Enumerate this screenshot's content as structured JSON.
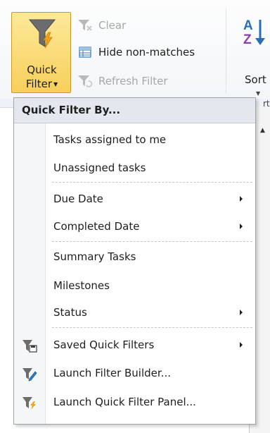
{
  "ribbon": {
    "quick_filter": {
      "line1": "Quick",
      "line2": "Filter",
      "icon": "funnel-lightning-icon"
    },
    "clear": {
      "label": "Clear",
      "icon": "funnel-clear-icon"
    },
    "hide_non_matches": {
      "label": "Hide non-matches",
      "icon": "table-hide-icon"
    },
    "refresh_filter": {
      "label": "Refresh Filter",
      "icon": "funnel-refresh-icon"
    },
    "sort": {
      "label": "Sort",
      "icon": "sort-az-icon",
      "partial_below": "rt"
    }
  },
  "menu": {
    "header": "Quick Filter By...",
    "items": [
      {
        "label": "Tasks assigned to me"
      },
      {
        "label": "Unassigned tasks"
      },
      {
        "label": "Due Date",
        "submenu": true
      },
      {
        "label": "Completed Date",
        "submenu": true
      },
      {
        "label": "Summary Tasks"
      },
      {
        "label": "Milestones"
      },
      {
        "label": "Status",
        "submenu": true
      },
      {
        "label": "Saved Quick Filters",
        "submenu": true,
        "icon": "funnel-saved-icon"
      },
      {
        "label": "Launch Filter Builder...",
        "icon": "funnel-builder-icon"
      },
      {
        "label": "Launch Quick Filter Panel...",
        "icon": "funnel-panel-icon"
      }
    ]
  },
  "colors": {
    "accent_button": "#f7cf5b",
    "menu_header_bg": "#e4e8ee",
    "funnel_gray": "#6c6c6c",
    "lightning_orange": "#f1a21b",
    "sort_blue": "#2a6db5",
    "sort_purple": "#8a3fb2"
  }
}
